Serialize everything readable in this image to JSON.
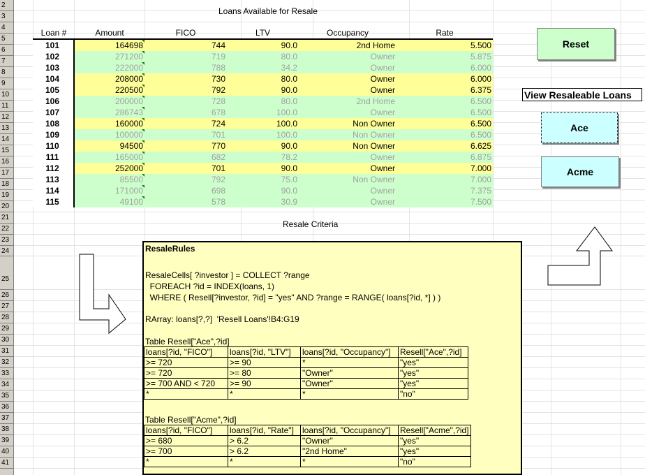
{
  "titles": {
    "loans": "Loans Available for Resale",
    "criteria": "Resale Criteria"
  },
  "headers": [
    "Loan #",
    "Amount",
    "FICO",
    "LTV",
    "Occupancy",
    "Rate"
  ],
  "loans": [
    {
      "id": "101",
      "amount": "164698",
      "fico": "744",
      "ltv": "90.0",
      "occ": "2nd Home",
      "rate": "5.500",
      "resaleable": true
    },
    {
      "id": "102",
      "amount": "271200",
      "fico": "719",
      "ltv": "80.0",
      "occ": "Owner",
      "rate": "5.875",
      "resaleable": false
    },
    {
      "id": "103",
      "amount": "222000",
      "fico": "788",
      "ltv": "34.2",
      "occ": "Owner",
      "rate": "6.000",
      "resaleable": false
    },
    {
      "id": "104",
      "amount": "208000",
      "fico": "730",
      "ltv": "80.0",
      "occ": "Owner",
      "rate": "6.000",
      "resaleable": true
    },
    {
      "id": "105",
      "amount": "220500",
      "fico": "792",
      "ltv": "90.0",
      "occ": "Owner",
      "rate": "6.375",
      "resaleable": true
    },
    {
      "id": "106",
      "amount": "200000",
      "fico": "728",
      "ltv": "80.0",
      "occ": "2nd Home",
      "rate": "6.500",
      "resaleable": false
    },
    {
      "id": "107",
      "amount": "286743",
      "fico": "678",
      "ltv": "100.0",
      "occ": "Owner",
      "rate": "6.500",
      "resaleable": false
    },
    {
      "id": "108",
      "amount": "160000",
      "fico": "724",
      "ltv": "100.0",
      "occ": "Non Owner",
      "rate": "6.500",
      "resaleable": true
    },
    {
      "id": "109",
      "amount": "100000",
      "fico": "701",
      "ltv": "100.0",
      "occ": "Non Owner",
      "rate": "6.500",
      "resaleable": false
    },
    {
      "id": "110",
      "amount": "94500",
      "fico": "770",
      "ltv": "90.0",
      "occ": "Non Owner",
      "rate": "6.625",
      "resaleable": true
    },
    {
      "id": "111",
      "amount": "165000",
      "fico": "682",
      "ltv": "78.2",
      "occ": "Owner",
      "rate": "6.875",
      "resaleable": false
    },
    {
      "id": "112",
      "amount": "252000",
      "fico": "701",
      "ltv": "90.0",
      "occ": "Owner",
      "rate": "7.000",
      "resaleable": true
    },
    {
      "id": "113",
      "amount": "85500",
      "fico": "792",
      "ltv": "75.0",
      "occ": "Non Owner",
      "rate": "7.000",
      "resaleable": false
    },
    {
      "id": "114",
      "amount": "171000",
      "fico": "698",
      "ltv": "90.0",
      "occ": "Owner",
      "rate": "7.375",
      "resaleable": false
    },
    {
      "id": "115",
      "amount": "49100",
      "fico": "578",
      "ltv": "30.9",
      "occ": "Owner",
      "rate": "7.500",
      "resaleable": false
    }
  ],
  "buttons": {
    "reset": "Reset",
    "view_label": "View Resaleable Loans",
    "ace": "Ace",
    "acme": "Acme"
  },
  "rules": {
    "title": "ResaleRules",
    "cells_line1": "ResaleCells[ ?investor ] = COLLECT ?range",
    "cells_line2": "  FOREACH ?id = INDEX(loans, 1)",
    "cells_line3": "  WHERE ( Resell[?investor, ?id] = \"yes\" AND ?range = RANGE( loans[?id, *] ) )",
    "rarray": "RArray: loans[?,?]  'Resell Loans'!B4:G19",
    "ace_table_title": "Table Resell[\"Ace\",?id]",
    "ace_table": [
      [
        "loans[?id, \"FICO\"]",
        "loans[?id, \"LTV\"]",
        "loans[?id, \"Occupancy\"]",
        "Resell[\"Ace\",?id]"
      ],
      [
        ">= 720",
        ">= 90",
        "*",
        "\"yes\""
      ],
      [
        ">= 720",
        ">= 80",
        "\"Owner\"",
        "\"yes\""
      ],
      [
        ">= 700 AND < 720",
        ">= 90",
        "\"Owner\"",
        "\"yes\""
      ],
      [
        "*",
        "*",
        "*",
        "\"no\""
      ]
    ],
    "acme_table_title": "Table Resell[\"Acme\",?id]",
    "acme_table": [
      [
        "loans[?id, \"FICO\"]",
        "loans[?id, \"Rate\"]",
        "loans[?id, \"Occupancy\"]",
        "Resell[\"Acme\",?id]"
      ],
      [
        ">= 680",
        "> 6.2",
        "\"Owner\"",
        "\"yes\""
      ],
      [
        ">= 700",
        "> 6.2",
        "\"2nd Home\"",
        "\"yes\""
      ],
      [
        "*",
        "*",
        "*",
        "\"no\""
      ]
    ]
  },
  "colors": {
    "yellow_row": "#ffff99",
    "green_row": "#ccffcc",
    "button_green": "#ccffcc",
    "button_cyan": "#ccffff",
    "rules_bg": "#ffffc0"
  }
}
